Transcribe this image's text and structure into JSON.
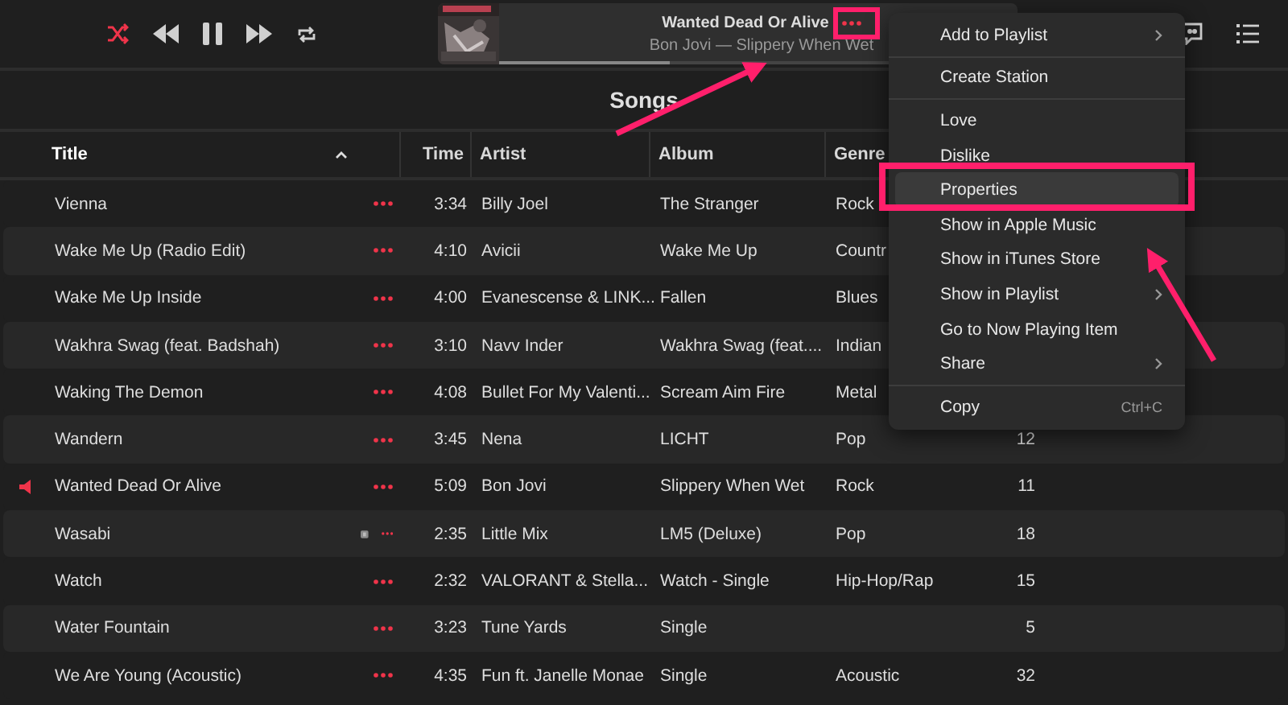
{
  "controls": {
    "shuffle_on": true,
    "playing": true
  },
  "now_playing": {
    "title": "Wanted Dead Or Alive",
    "subtitle": "Bon Jovi — Slippery When Wet",
    "level": 0.33
  },
  "heading": "Songs",
  "table": {
    "columns": [
      {
        "label": "Title",
        "sorted": true
      },
      {
        "label": "Time",
        "sorted": false
      },
      {
        "label": "Artist",
        "sorted": false
      },
      {
        "label": "Album",
        "sorted": false
      },
      {
        "label": "Genre",
        "sorted": false
      }
    ],
    "rows": [
      {
        "title": "Vienna",
        "time": "3:34",
        "artist": "Billy Joel",
        "album": "The Stranger",
        "genre": "Rock",
        "playing": false,
        "explicit": false
      },
      {
        "title": "Wake Me Up (Radio Edit)",
        "time": "4:10",
        "artist": "Avicii",
        "album": "Wake Me Up",
        "genre": "Countr",
        "playing": false,
        "explicit": false
      },
      {
        "title": "Wake Me Up Inside",
        "time": "4:00",
        "artist": "Evanescense & LINK...",
        "album": "Fallen",
        "genre": "Blues",
        "playing": false,
        "explicit": false
      },
      {
        "title": "Wakhra Swag (feat. Badshah)",
        "time": "3:10",
        "artist": "Navv Inder",
        "album": "Wakhra Swag (feat....",
        "genre": "Indian",
        "playing": false,
        "explicit": false
      },
      {
        "title": "Waking The Demon",
        "time": "4:08",
        "artist": "Bullet For My Valenti...",
        "album": "Scream Aim Fire",
        "genre": "Metal",
        "playing": false,
        "explicit": false
      },
      {
        "title": "Wandern",
        "time": "3:45",
        "artist": "Nena",
        "album": "LICHT",
        "genre": "Pop",
        "plays": "12",
        "playing": false,
        "explicit": false
      },
      {
        "title": "Wanted Dead Or Alive",
        "time": "5:09",
        "artist": "Bon Jovi",
        "album": "Slippery When Wet",
        "genre": "Rock",
        "plays": "11",
        "playing": true,
        "explicit": false
      },
      {
        "title": "Wasabi",
        "time": "2:35",
        "artist": "Little Mix",
        "album": "LM5 (Deluxe)",
        "genre": "Pop",
        "plays": "18",
        "playing": false,
        "explicit": true
      },
      {
        "title": "Watch",
        "time": "2:32",
        "artist": "VALORANT & Stella...",
        "album": "Watch - Single",
        "genre": "Hip-Hop/Rap",
        "plays": "15",
        "playing": false,
        "explicit": false
      },
      {
        "title": "Water Fountain",
        "time": "3:23",
        "artist": "Tune Yards",
        "album": "Single",
        "plays": "5",
        "playing": false,
        "explicit": false
      },
      {
        "title": "We Are Young (Acoustic)",
        "time": "4:35",
        "artist": "Fun ft. Janelle Monae",
        "album": "Single",
        "genre": "Acoustic",
        "plays": "32",
        "playing": false,
        "explicit": false
      }
    ]
  },
  "context_menu": {
    "groups": [
      [
        {
          "label": "Add to Playlist",
          "submenu": true,
          "highlighted": false
        }
      ],
      [
        {
          "label": "Create Station",
          "submenu": false,
          "highlighted": false
        }
      ],
      [
        {
          "label": "Love",
          "submenu": false,
          "highlighted": false
        },
        {
          "label": "Dislike",
          "submenu": false,
          "highlighted": false
        },
        {
          "label": "Properties",
          "submenu": false,
          "highlighted": true
        },
        {
          "label": "Show in Apple Music",
          "submenu": false,
          "highlighted": false
        },
        {
          "label": "Show in iTunes Store",
          "submenu": false,
          "highlighted": false
        },
        {
          "label": "Show in Playlist",
          "submenu": true,
          "highlighted": false
        },
        {
          "label": "Go to Now Playing Item",
          "submenu": false,
          "highlighted": false
        },
        {
          "label": "Share",
          "submenu": true,
          "highlighted": false
        }
      ],
      [
        {
          "label": "Copy",
          "shortcut": "Ctrl+C",
          "submenu": false,
          "highlighted": false
        }
      ]
    ]
  }
}
